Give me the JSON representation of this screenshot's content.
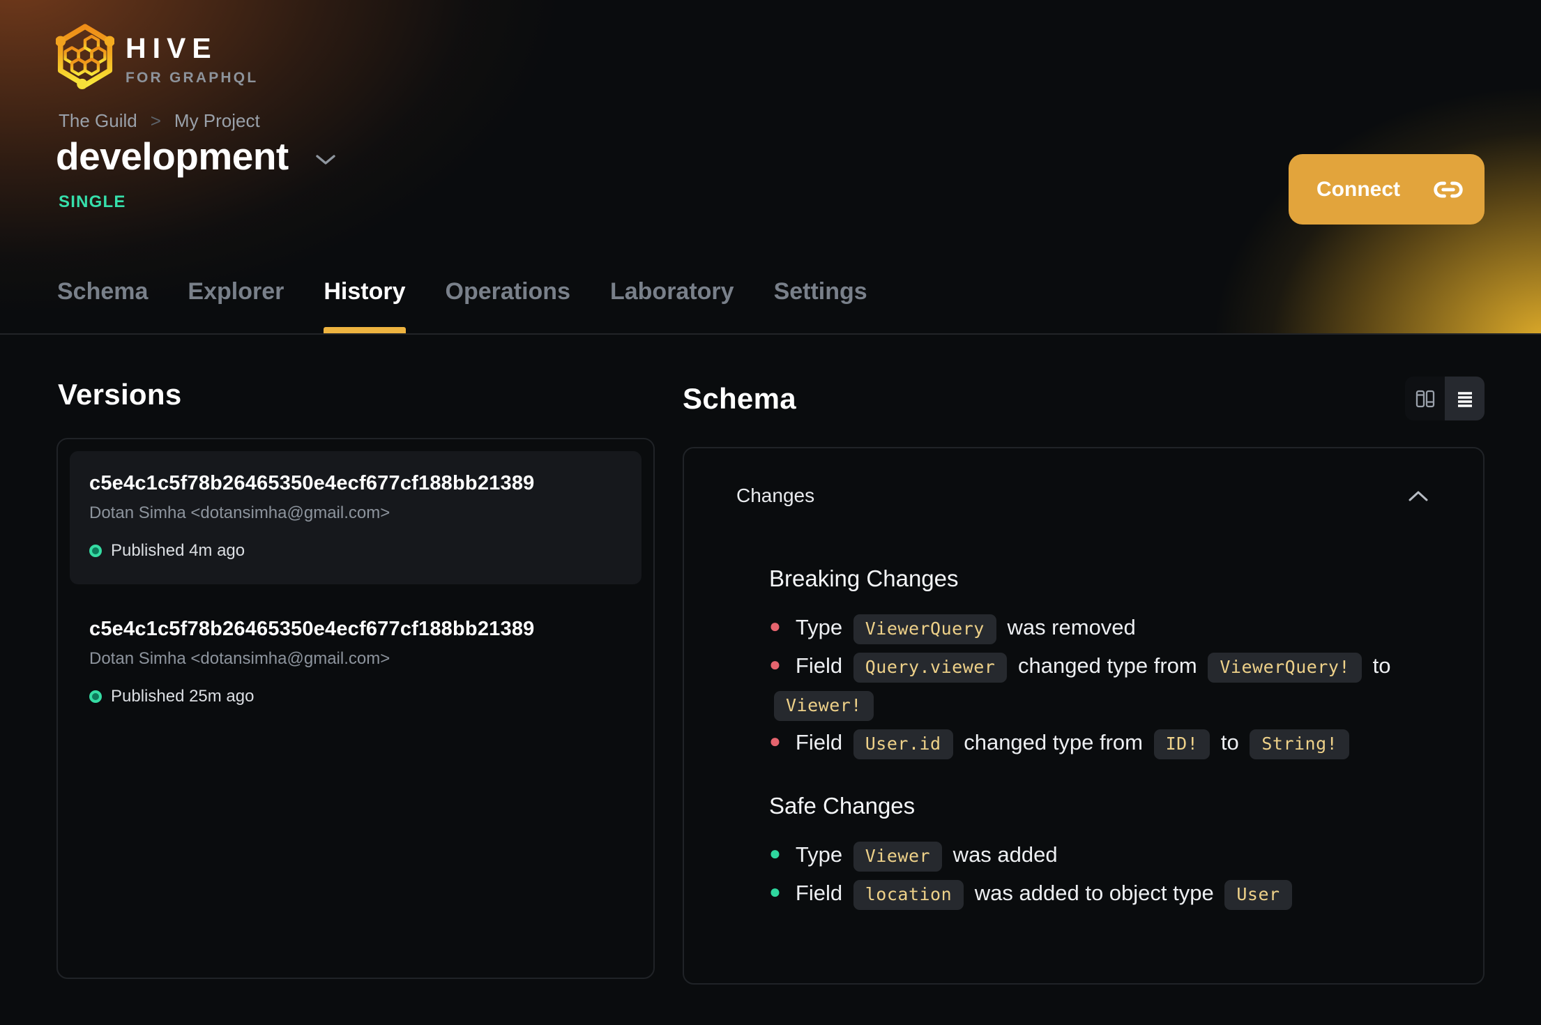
{
  "brand": {
    "name": "HIVE",
    "tagline": "FOR GRAPHQL"
  },
  "breadcrumb": {
    "items": [
      "The Guild",
      "My Project"
    ],
    "separator": ">"
  },
  "project": {
    "name": "development",
    "badge": "SINGLE"
  },
  "actions": {
    "connect_label": "Connect"
  },
  "tabs": [
    {
      "label": "Schema",
      "active": false
    },
    {
      "label": "Explorer",
      "active": false
    },
    {
      "label": "History",
      "active": true
    },
    {
      "label": "Operations",
      "active": false
    },
    {
      "label": "Laboratory",
      "active": false
    },
    {
      "label": "Settings",
      "active": false
    }
  ],
  "versions": {
    "title": "Versions",
    "items": [
      {
        "hash": "c5e4c1c5f78b26465350e4ecf677cf188bb21389",
        "author": "Dotan Simha <dotansimha@gmail.com>",
        "status": "Published 4m ago",
        "selected": true
      },
      {
        "hash": "c5e4c1c5f78b26465350e4ecf677cf188bb21389",
        "author": "Dotan Simha <dotansimha@gmail.com>",
        "status": "Published 25m ago",
        "selected": false
      }
    ]
  },
  "schema": {
    "title": "Schema",
    "collapse_header": "Changes",
    "sections": [
      {
        "title": "Breaking Changes",
        "kind": "breaking",
        "bullet_color": "#e5646e",
        "items": [
          {
            "segments": [
              {
                "text": "Type "
              },
              {
                "code": "ViewerQuery"
              },
              {
                "text": " was removed"
              }
            ]
          },
          {
            "segments": [
              {
                "text": "Field "
              },
              {
                "code": "Query.viewer"
              },
              {
                "text": " changed type from "
              },
              {
                "code": "ViewerQuery!"
              },
              {
                "text": " to "
              },
              {
                "code": "Viewer!"
              }
            ]
          },
          {
            "segments": [
              {
                "text": "Field "
              },
              {
                "code": "User.id"
              },
              {
                "text": " changed type from "
              },
              {
                "code": "ID!"
              },
              {
                "text": " to "
              },
              {
                "code": "String!"
              }
            ]
          }
        ]
      },
      {
        "title": "Safe Changes",
        "kind": "safe",
        "bullet_color": "#2fd79e",
        "items": [
          {
            "segments": [
              {
                "text": "Type "
              },
              {
                "code": "Viewer"
              },
              {
                "text": " was added"
              }
            ]
          },
          {
            "segments": [
              {
                "text": "Field "
              },
              {
                "code": "location"
              },
              {
                "text": " was added to object type "
              },
              {
                "code": "User"
              }
            ]
          }
        ]
      }
    ]
  },
  "icons": {
    "logo": "hive-honeycomb-hexagon",
    "title_caret": "chevron-down",
    "connect": "link",
    "view_columns": "columns-layout",
    "view_list": "list-rows",
    "collapse": "chevron-up",
    "published": "status-dot"
  },
  "colors": {
    "accent_amber": "#eeb440",
    "connect_button": "#e2a43c",
    "badge_green": "#36dfab",
    "breaking_bullet": "#e5646e",
    "safe_bullet": "#2fd79e",
    "code_text": "#eed189",
    "code_bg": "#26292e",
    "panel_border": "#202327",
    "card_bg": "#16181c",
    "page_bg": "#0a0c0e"
  }
}
